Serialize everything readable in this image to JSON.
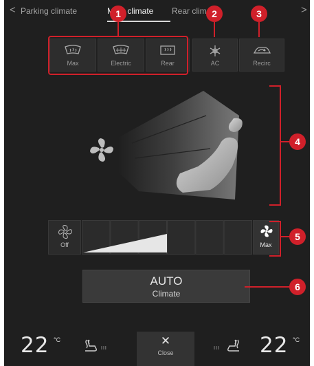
{
  "tabs": {
    "left_arrow": "<",
    "right_arrow": ">",
    "items": [
      {
        "label": "Parking climate",
        "active": false
      },
      {
        "label": "Main climate",
        "active": true
      },
      {
        "label": "Rear climate",
        "active": false
      }
    ]
  },
  "defrost_buttons": [
    {
      "label": "Max",
      "icon": "max-defrost-icon"
    },
    {
      "label": "Electric",
      "icon": "electric-windshield-icon"
    },
    {
      "label": "Rear",
      "icon": "rear-defrost-icon"
    }
  ],
  "ac_button": {
    "label": "AC",
    "icon": "ac-snowflake-icon"
  },
  "recirc_button": {
    "label": "Recirc",
    "icon": "recirculation-icon"
  },
  "fan": {
    "off_label": "Off",
    "max_label": "Max",
    "level_fraction": 0.5,
    "segments": 6
  },
  "auto_button": {
    "main": "AUTO",
    "sub": "Climate"
  },
  "bottom": {
    "left_temp": "22",
    "right_temp": "22",
    "unit": "°C",
    "heat_level_left": "III",
    "heat_level_right": "III",
    "close_symbol": "✕",
    "close_label": "Close"
  },
  "callouts": [
    "1",
    "2",
    "3",
    "4",
    "5",
    "6"
  ],
  "colors": {
    "background": "#1f1f1f",
    "callout_red": "#d0202a",
    "panel": "#2d2d2d"
  }
}
